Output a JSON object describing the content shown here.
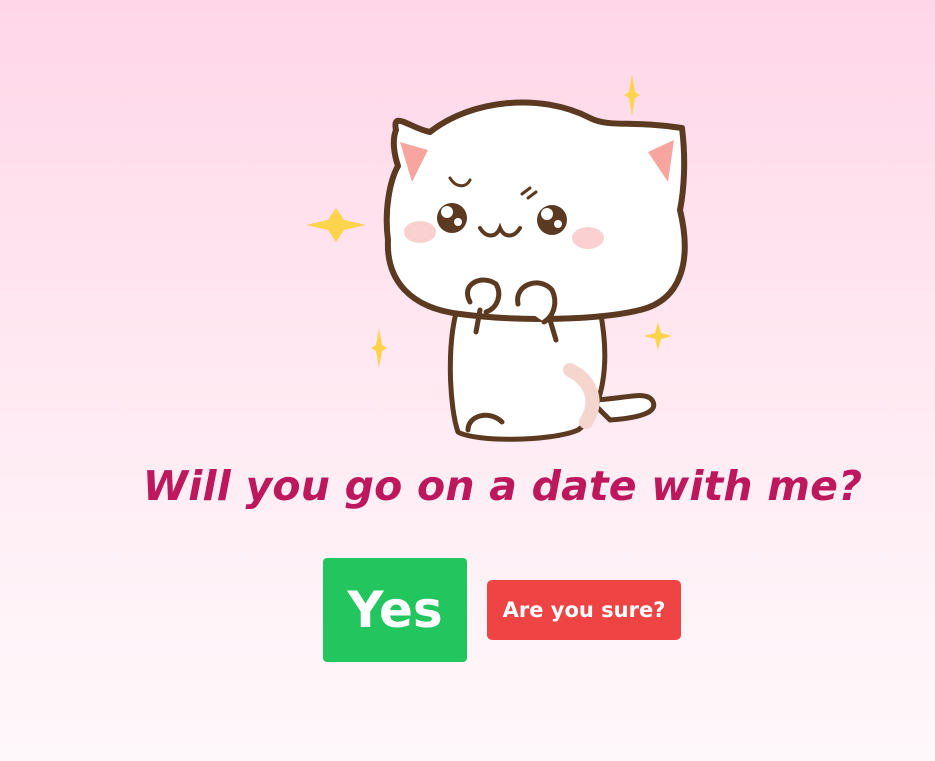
{
  "sticker": {
    "icon": "cute-cat-sticker-icon",
    "accent_colors": [
      "#5c3a21",
      "#fbd34d",
      "#f7a7a7"
    ]
  },
  "question": {
    "text": "Will you go on a date with me?",
    "color": "#be185d"
  },
  "buttons": {
    "yes_label": "Yes",
    "yes_color": "#22c55e",
    "no_label": "Are you sure?",
    "no_color": "#ef4444"
  }
}
